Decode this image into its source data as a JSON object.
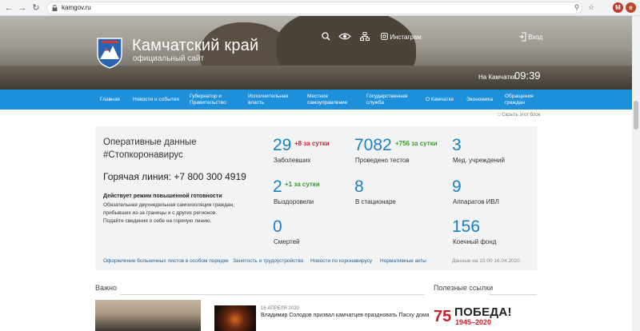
{
  "browser": {
    "url": "kamgov.ru",
    "avatar_letter": "M",
    "ext_letter": "e"
  },
  "header": {
    "title": "Камчатский край",
    "subtitle": "официальный сайт",
    "instagram": "Инстаграм",
    "login": "Вход",
    "time_label": "На Камчатке",
    "time_value": "09:39"
  },
  "nav": [
    {
      "label": "Главная"
    },
    {
      "label": "Новости и события"
    },
    {
      "label": "Губернатор и Правительство"
    },
    {
      "label": "Исполнительная власть"
    },
    {
      "label": "Местное самоуправление"
    },
    {
      "label": "Государственная служба"
    },
    {
      "label": "О Камчатке"
    },
    {
      "label": "Экономика"
    },
    {
      "label": "Обращения граждан"
    }
  ],
  "hide_block": "Скрыть этот блок",
  "covid": {
    "title1": "Оперативные данные",
    "title2": "#Стопкоронавирус",
    "hotline": "Горячая линия: +7 800 300 4919",
    "bold": "Действует режим повышенной готовности",
    "text1": "Обязательная двухнедельная самоизоляция граждан,",
    "text2": "прибывших из-за границы и с других регионов.",
    "text3": "Подайте сведения о себе на горячую линию.",
    "stats": [
      {
        "value": "29",
        "delta": "+8 за сутки",
        "label": "Заболевших"
      },
      {
        "value": "7082",
        "delta": "+756 за сутки",
        "label": "Проведено тестов"
      },
      {
        "value": "3",
        "delta": "",
        "label": "Мед. учреждений"
      },
      {
        "value": "2",
        "delta": "+1 за сутки",
        "label": "Выздоровели"
      },
      {
        "value": "8",
        "delta": "",
        "label": "В стационаре"
      },
      {
        "value": "9",
        "delta": "",
        "label": "Аппаратов ИВЛ"
      },
      {
        "value": "0",
        "delta": "",
        "label": "Смертей"
      },
      {
        "value": "156",
        "delta": "",
        "label": "Коечный фонд"
      }
    ],
    "links": [
      "Оформление больничных листов в особом порядке",
      "Занятость и трудоустройство",
      "Новости по коронавирусу",
      "Нормативные акты"
    ],
    "date": "Данные на 15:00 16.04.2020"
  },
  "sections": {
    "important": "Важно",
    "useful": "Полезные ссылки"
  },
  "news": {
    "date": "16 АПРЕЛЯ 2020",
    "title": "Владимир Солодов призвал камчатцев праздновать Пасху дома"
  },
  "pobeda": {
    "text": "ПОБЕДА!",
    "years": "1945–2020",
    "badge": "75"
  },
  "colors": {
    "nav": "#1e8fd9",
    "stat": "#1e7fbf",
    "delta_red": "#c0262d",
    "delta_green": "#3d9a2b"
  }
}
